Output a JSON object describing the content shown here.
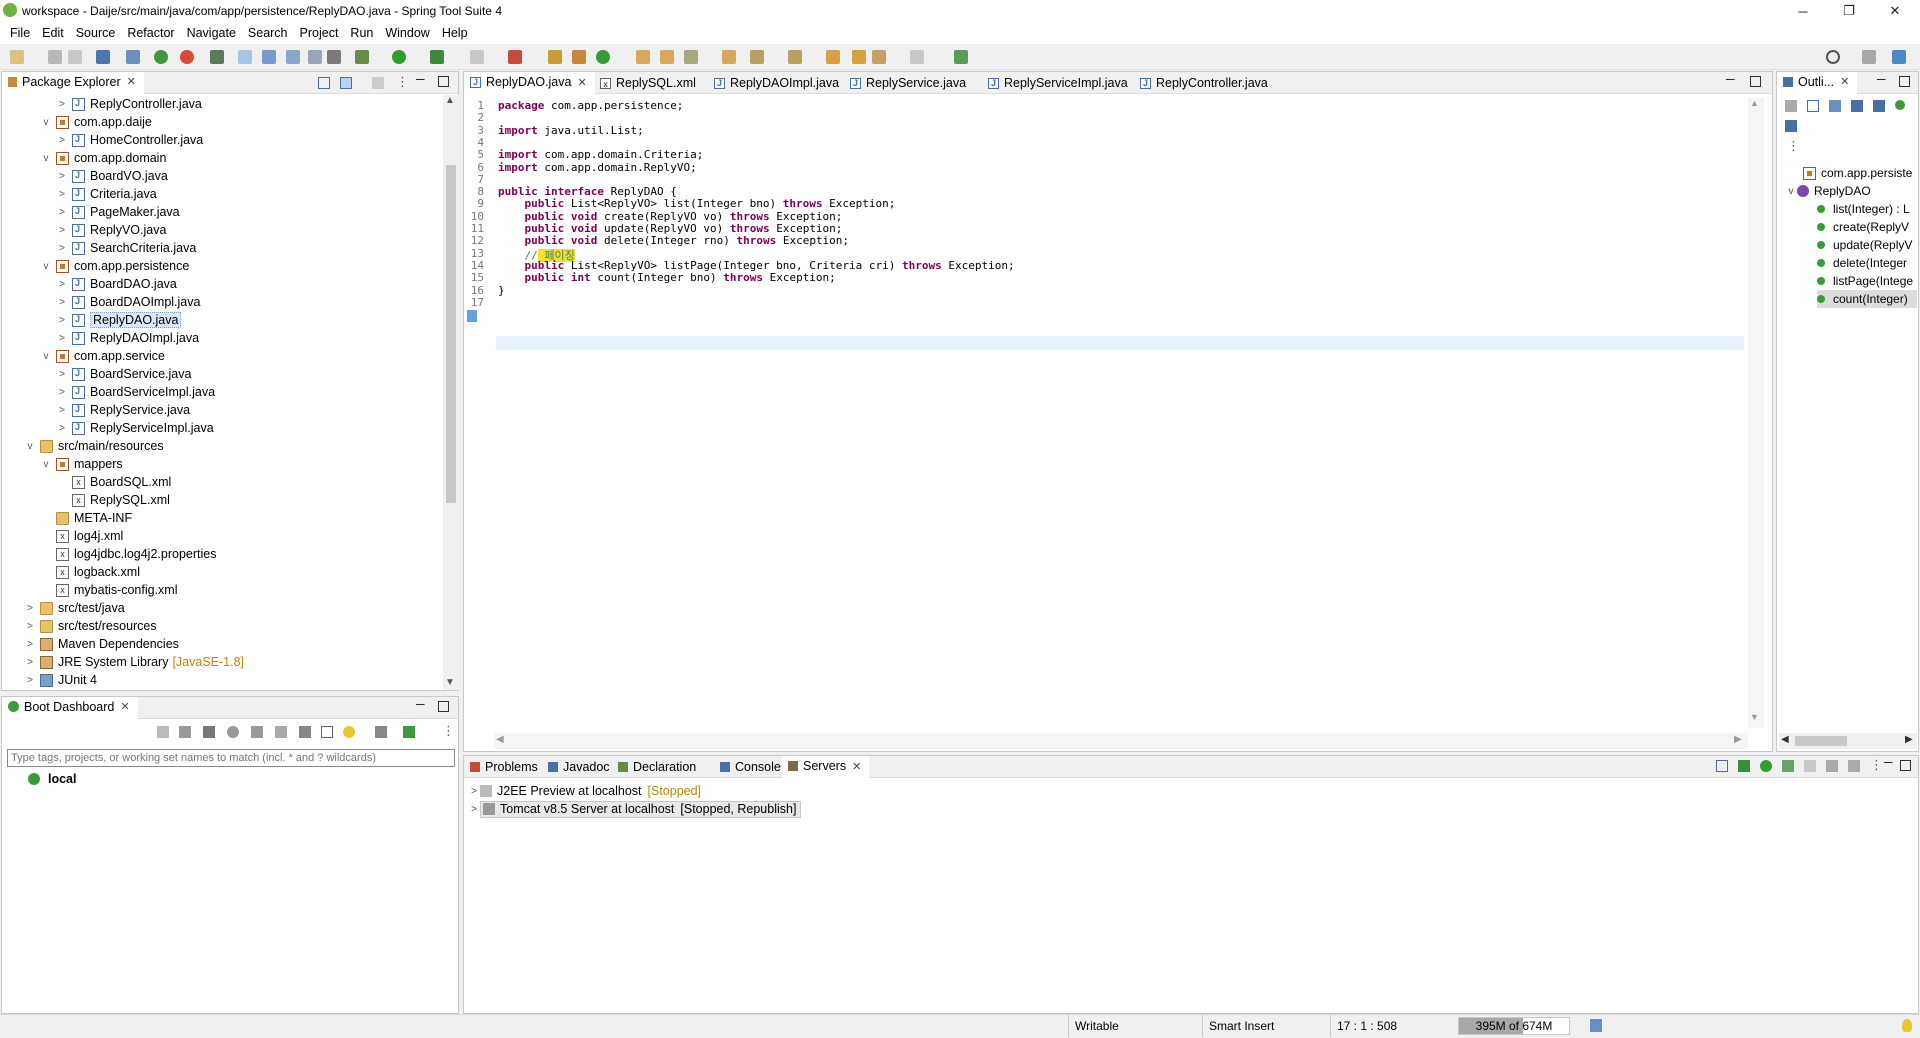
{
  "window": {
    "title": "workspace - Daije/src/main/java/com/app/persistence/ReplyDAO.java - Spring Tool Suite 4",
    "minimize": "─",
    "maximize": "❐",
    "close": "✕"
  },
  "menu": [
    "File",
    "Edit",
    "Source",
    "Refactor",
    "Navigate",
    "Search",
    "Project",
    "Run",
    "Window",
    "Help"
  ],
  "package_explorer": {
    "title": "Package Explorer",
    "items": [
      {
        "label": "ReplyController.java",
        "indent": 3,
        "icon": "java",
        "twisty": ">"
      },
      {
        "label": "com.app.daije",
        "indent": 2,
        "icon": "pkg",
        "twisty": "v"
      },
      {
        "label": "HomeController.java",
        "indent": 3,
        "icon": "java",
        "twisty": ">"
      },
      {
        "label": "com.app.domain",
        "indent": 2,
        "icon": "pkg",
        "twisty": "v"
      },
      {
        "label": "BoardVO.java",
        "indent": 3,
        "icon": "java",
        "twisty": ">"
      },
      {
        "label": "Criteria.java",
        "indent": 3,
        "icon": "java",
        "twisty": ">"
      },
      {
        "label": "PageMaker.java",
        "indent": 3,
        "icon": "java",
        "twisty": ">"
      },
      {
        "label": "ReplyVO.java",
        "indent": 3,
        "icon": "java",
        "twisty": ">"
      },
      {
        "label": "SearchCriteria.java",
        "indent": 3,
        "icon": "java",
        "twisty": ">"
      },
      {
        "label": "com.app.persistence",
        "indent": 2,
        "icon": "pkg",
        "twisty": "v"
      },
      {
        "label": "BoardDAO.java",
        "indent": 3,
        "icon": "java",
        "twisty": ">"
      },
      {
        "label": "BoardDAOImpl.java",
        "indent": 3,
        "icon": "java",
        "twisty": ">"
      },
      {
        "label": "ReplyDAO.java",
        "indent": 3,
        "icon": "java",
        "twisty": ">",
        "selected": true
      },
      {
        "label": "ReplyDAOImpl.java",
        "indent": 3,
        "icon": "java",
        "twisty": ">"
      },
      {
        "label": "com.app.service",
        "indent": 2,
        "icon": "pkg",
        "twisty": "v"
      },
      {
        "label": "BoardService.java",
        "indent": 3,
        "icon": "java",
        "twisty": ">"
      },
      {
        "label": "BoardServiceImpl.java",
        "indent": 3,
        "icon": "java",
        "twisty": ">"
      },
      {
        "label": "ReplyService.java",
        "indent": 3,
        "icon": "java",
        "twisty": ">"
      },
      {
        "label": "ReplyServiceImpl.java",
        "indent": 3,
        "icon": "java",
        "twisty": ">"
      },
      {
        "label": "src/main/resources",
        "indent": 1,
        "icon": "folder",
        "twisty": "v"
      },
      {
        "label": "mappers",
        "indent": 2,
        "icon": "pkg",
        "twisty": "v"
      },
      {
        "label": "BoardSQL.xml",
        "indent": 3,
        "icon": "xml",
        "twisty": ""
      },
      {
        "label": "ReplySQL.xml",
        "indent": 3,
        "icon": "xml",
        "twisty": ""
      },
      {
        "label": "META-INF",
        "indent": 2,
        "icon": "folder",
        "twisty": ""
      },
      {
        "label": "log4j.xml",
        "indent": 2,
        "icon": "xml",
        "twisty": ""
      },
      {
        "label": "log4jdbc.log4j2.properties",
        "indent": 2,
        "icon": "xml",
        "twisty": ""
      },
      {
        "label": "logback.xml",
        "indent": 2,
        "icon": "xml",
        "twisty": ""
      },
      {
        "label": "mybatis-config.xml",
        "indent": 2,
        "icon": "xml",
        "twisty": ""
      },
      {
        "label": "src/test/java",
        "indent": 1,
        "icon": "folder",
        "twisty": ">"
      },
      {
        "label": "src/test/resources",
        "indent": 1,
        "icon": "folder",
        "twisty": ">"
      },
      {
        "label": "Maven Dependencies",
        "indent": 1,
        "icon": "lib",
        "twisty": ">"
      },
      {
        "label": "JRE System Library",
        "suffix": "[JavaSE-1.8]",
        "indent": 1,
        "icon": "lib",
        "twisty": ">"
      },
      {
        "label": "JUnit 4",
        "indent": 1,
        "icon": "jar",
        "twisty": ">"
      }
    ]
  },
  "boot_dashboard": {
    "title": "Boot Dashboard",
    "filter_placeholder": "Type tags, projects, or working set names to match (incl. * and ? wildcards)",
    "local": "local"
  },
  "editor": {
    "tabs": [
      {
        "label": "ReplyDAO.java",
        "active": true
      },
      {
        "label": "ReplySQL.xml"
      },
      {
        "label": "ReplyDAOImpl.java"
      },
      {
        "label": "ReplyService.java"
      },
      {
        "label": "ReplyServiceImpl.java"
      },
      {
        "label": "ReplyController.java"
      }
    ],
    "lines": [
      "package com.app.persistence;",
      "",
      "import java.util.List;",
      "",
      "import com.app.domain.Criteria;",
      "import com.app.domain.ReplyVO;",
      "",
      "public interface ReplyDAO {",
      "    public List<ReplyVO> list(Integer bno) throws Exception;",
      "    public void create(ReplyVO vo) throws Exception;",
      "    public void update(ReplyVO vo) throws Exception;",
      "    public void delete(Integer rno) throws Exception;",
      "    // 페이징",
      "    public List<ReplyVO> listPage(Integer bno, Criteria cri) throws Exception;",
      "    public int count(Integer bno) throws Exception;",
      "}",
      ""
    ]
  },
  "outline": {
    "title": "Outli...",
    "package": "com.app.persiste",
    "interface": "ReplyDAO",
    "methods": [
      "list(Integer) : L",
      "create(ReplyV",
      "update(ReplyV",
      "delete(Integer",
      "listPage(Intege",
      "count(Integer)"
    ]
  },
  "bottom": {
    "tabs": [
      "Problems",
      "Javadoc",
      "Declaration",
      "Console",
      "Servers"
    ],
    "servers": [
      {
        "name": "J2EE Preview at localhost",
        "state": "[Stopped]"
      },
      {
        "name": "Tomcat v8.5 Server at localhost",
        "state": "[Stopped, Republish]"
      }
    ]
  },
  "status": {
    "writable": "Writable",
    "insert": "Smart Insert",
    "position": "17 : 1 : 508",
    "memory": "395M of 674M",
    "memory_fraction": 0.586
  },
  "colors": {
    "keyword": "#7f0055",
    "comment": "#3f7f5f",
    "selection": "#dbe8f9",
    "spring_green": "#6db33f"
  }
}
